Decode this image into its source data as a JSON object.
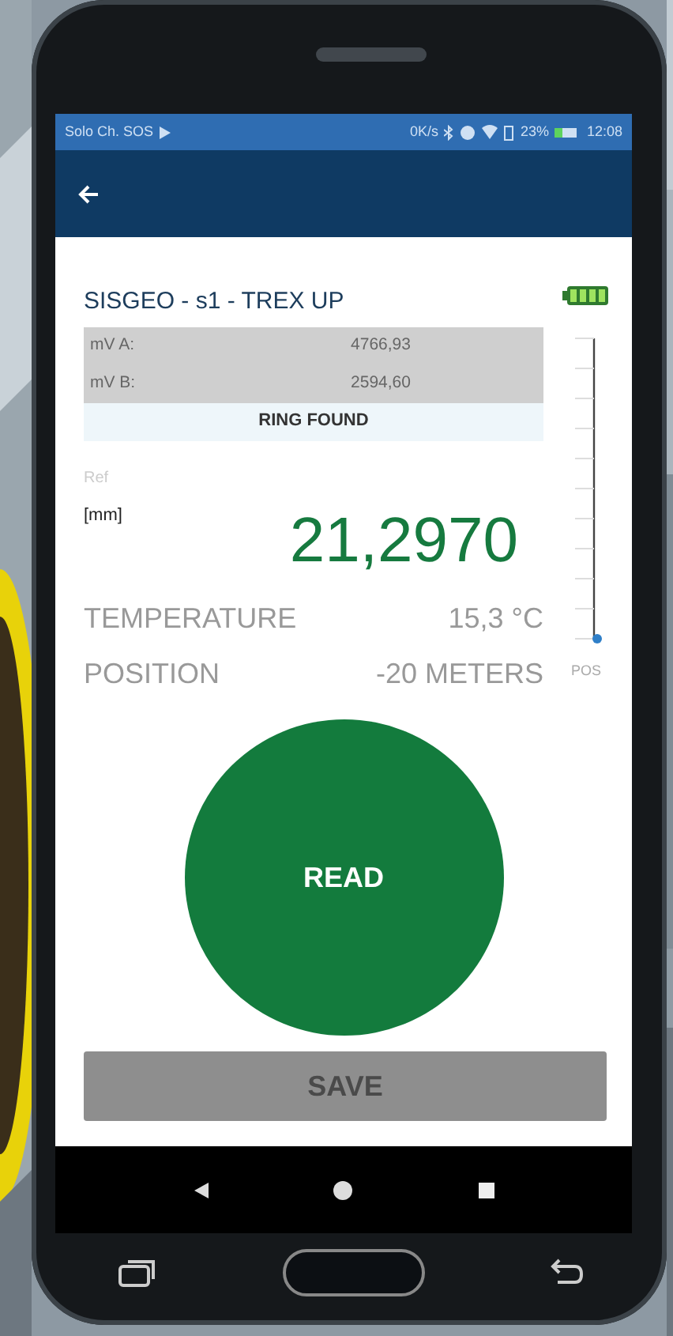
{
  "status_bar": {
    "left": "Solo Ch. SOS",
    "speed": "0K/s",
    "battery": "23%",
    "time": "12:08"
  },
  "sensor": {
    "title": "SISGEO - s1 - TREX UP",
    "readings": [
      {
        "label": "mV A:",
        "value": "4766,93"
      },
      {
        "label": "mV B:",
        "value": "2594,60"
      }
    ],
    "ring_status": "RING FOUND",
    "ref_label": "Ref",
    "unit": "[mm]",
    "value": "21,2970",
    "temperature": {
      "label": "TEMPERATURE",
      "value": "15,3 °C"
    },
    "position": {
      "label": "POSITION",
      "value": "-20 METERS"
    },
    "position_scale": {
      "level": 0,
      "label": "POS"
    }
  },
  "read_button": "READ",
  "save_button": {
    "label": "SAVE",
    "disabled": true
  }
}
